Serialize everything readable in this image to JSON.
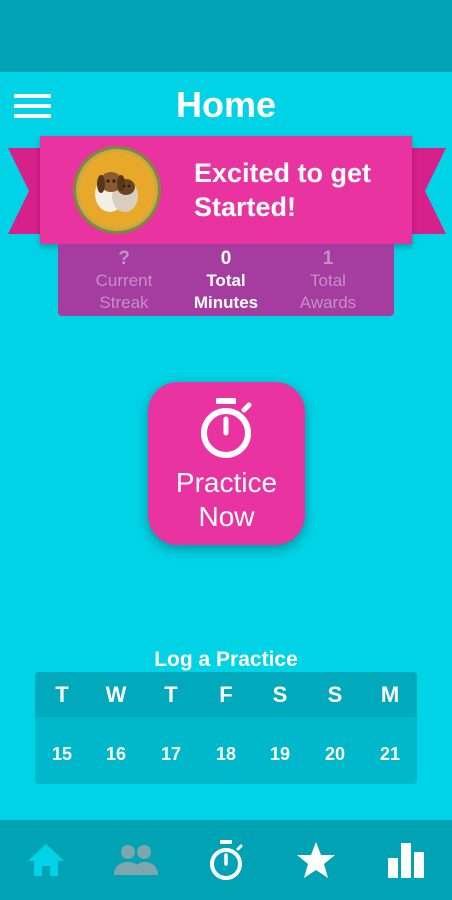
{
  "header": {
    "title": "Home",
    "menu_icon": "hamburger-menu-icon"
  },
  "banner": {
    "message": "Excited to get Started!",
    "badge_icon": "dog-badge-icon"
  },
  "stats": [
    {
      "value": "?",
      "label_line1": "Current",
      "label_line2": "Streak"
    },
    {
      "value": "0",
      "label_line1": "Total",
      "label_line2": "Minutes"
    },
    {
      "value": "1",
      "label_line1": "Total",
      "label_line2": "Awards"
    }
  ],
  "practice_button": {
    "line1": "Practice",
    "line2": "Now",
    "icon": "stopwatch-icon"
  },
  "log": {
    "title": "Log a Practice",
    "days": [
      "T",
      "W",
      "T",
      "F",
      "S",
      "S",
      "M"
    ],
    "dates": [
      "15",
      "16",
      "17",
      "18",
      "19",
      "20",
      "21"
    ]
  },
  "nav": [
    {
      "icon": "home-icon",
      "active": true
    },
    {
      "icon": "people-icon",
      "active": false
    },
    {
      "icon": "stopwatch-icon",
      "active": false
    },
    {
      "icon": "star-icon",
      "active": false
    },
    {
      "icon": "bar-chart-icon",
      "active": false
    }
  ],
  "colors": {
    "background": "#00d3e6",
    "bars": "#00a3b3",
    "accent_pink": "#e933a0",
    "stats_purple": "#a43d9f",
    "nav_active": "#00d3e6",
    "nav_inactive_people": "#7fa6ad"
  }
}
